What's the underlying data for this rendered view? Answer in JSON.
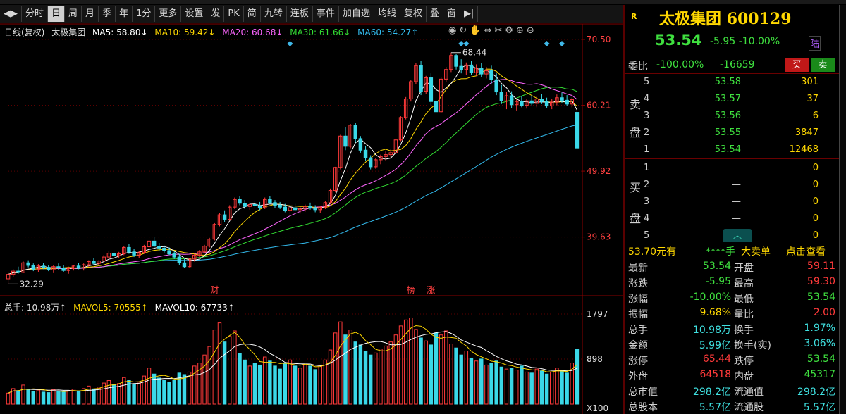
{
  "toolbar": {
    "items": [
      "◀▶",
      "分时",
      "日",
      "周",
      "月",
      "季",
      "年",
      "1分",
      "更多",
      "设置",
      "发",
      "PK",
      "简",
      "九转",
      "连板",
      "事件",
      "加自选",
      "均线",
      "复权",
      "叠",
      "窗",
      "▶|"
    ],
    "active_index": 2
  },
  "legend": {
    "period": "日线(复权)",
    "stock": "太极集团",
    "ma5": "MA5: 58.80↓",
    "ma10": "MA10: 59.42↓",
    "ma20": "MA20: 60.68↓",
    "ma30": "MA30: 61.66↓",
    "ma60": "MA60: 54.27↑"
  },
  "volume_legend": {
    "total": "总手: 10.98万↑",
    "mavol5": "MAVOL5: 70555↑",
    "mavol10": "MAVOL10: 67733↑"
  },
  "axis": {
    "price_ticks": [
      "70.50",
      "60.21",
      "49.92",
      "39.63"
    ],
    "volume_ticks": [
      "1797",
      "898",
      "X100"
    ]
  },
  "annotations": {
    "high": "68.44",
    "low": "32.29",
    "markers": [
      "财",
      "榜",
      "涨"
    ]
  },
  "quote": {
    "badge": "R",
    "name": "太极集团",
    "code": "600129",
    "price": "53.54",
    "change": "-5.95",
    "change_pct": "-10.00%",
    "market": "陆",
    "ratio_label": "委比",
    "ratio_pct": "-100.00%",
    "ratio_diff": "-16659",
    "buy_btn": "买",
    "sell_btn": "卖",
    "sell_side": [
      "卖",
      "盘"
    ],
    "buy_side": [
      "买",
      "盘"
    ],
    "asks": [
      {
        "level": "5",
        "price": "53.58",
        "qty": "301"
      },
      {
        "level": "4",
        "price": "53.57",
        "qty": "37"
      },
      {
        "level": "3",
        "price": "53.56",
        "qty": "6"
      },
      {
        "level": "2",
        "price": "53.55",
        "qty": "3847"
      },
      {
        "level": "1",
        "price": "53.54",
        "qty": "12468"
      }
    ],
    "bids": [
      {
        "level": "1",
        "price": "—",
        "qty": "0"
      },
      {
        "level": "2",
        "price": "—",
        "qty": "0"
      },
      {
        "level": "3",
        "price": "—",
        "qty": "0"
      },
      {
        "level": "4",
        "price": "—",
        "qty": "0"
      },
      {
        "level": "5",
        "price": "—",
        "qty": "0"
      }
    ],
    "level2": {
      "a": "53.70元有",
      "b": "****手",
      "c": "大卖单",
      "d": "点击查看"
    },
    "stats": [
      {
        "l1": "最新",
        "v1": "53.54",
        "c1": "green",
        "l2": "开盘",
        "v2": "59.11",
        "c2": "red"
      },
      {
        "l1": "涨跌",
        "v1": "-5.95",
        "c1": "green",
        "l2": "最高",
        "v2": "59.30",
        "c2": "red"
      },
      {
        "l1": "涨幅",
        "v1": "-10.00%",
        "c1": "green",
        "l2": "最低",
        "v2": "53.54",
        "c2": "green"
      },
      {
        "l1": "振幅",
        "v1": "9.68%",
        "c1": "yel",
        "l2": "量比",
        "v2": "2.00",
        "c2": "red"
      },
      {
        "l1": "总手",
        "v1": "10.98万",
        "c1": "cyan",
        "l2": "换手",
        "v2": "1.97%",
        "c2": "cyan"
      },
      {
        "l1": "金额",
        "v1": "5.99亿",
        "c1": "cyan",
        "l2": "换手(实)",
        "v2": "3.06%",
        "c2": "cyan"
      },
      {
        "l1": "涨停",
        "v1": "65.44",
        "c1": "red",
        "l2": "跌停",
        "v2": "53.54",
        "c2": "green"
      },
      {
        "l1": "外盘",
        "v1": "64518",
        "c1": "red",
        "l2": "内盘",
        "v2": "45317",
        "c2": "green"
      },
      {
        "l1": "总市值",
        "v1": "298.2亿",
        "c1": "cyan",
        "l2": "流通值",
        "v2": "298.2亿",
        "c2": "cyan"
      },
      {
        "l1": "总股本",
        "v1": "5.57亿",
        "c1": "cyan",
        "l2": "流通股",
        "v2": "5.57亿",
        "c2": "cyan"
      }
    ]
  },
  "colors": {
    "up": "#ff3a3a",
    "down": "#3ad8e8",
    "ma5": "#ffffff",
    "ma10": "#ffd800",
    "ma20": "#ff66ff",
    "ma30": "#33dd33",
    "ma60": "#33bbee",
    "axis": "#8a0000"
  },
  "chart_data": {
    "type": "candlestick",
    "y_range": [
      32,
      70.5
    ],
    "candles": [
      [
        33.1,
        34.2,
        32.29,
        33.8
      ],
      [
        33.8,
        34.6,
        33.4,
        34.3
      ],
      [
        34.3,
        35.0,
        33.9,
        34.1
      ],
      [
        34.1,
        35.8,
        34.0,
        35.6
      ],
      [
        35.6,
        36.0,
        34.9,
        35.2
      ],
      [
        35.2,
        35.5,
        34.3,
        34.6
      ],
      [
        34.6,
        35.4,
        34.2,
        35.1
      ],
      [
        35.1,
        35.6,
        34.6,
        34.9
      ],
      [
        34.9,
        35.3,
        34.3,
        34.5
      ],
      [
        34.5,
        35.2,
        34.0,
        35.0
      ],
      [
        35.0,
        35.5,
        34.5,
        34.8
      ],
      [
        34.8,
        35.3,
        34.2,
        34.4
      ],
      [
        34.4,
        35.0,
        33.9,
        34.7
      ],
      [
        34.7,
        35.3,
        34.4,
        35.1
      ],
      [
        35.1,
        35.6,
        34.6,
        34.8
      ],
      [
        34.8,
        35.5,
        34.4,
        35.3
      ],
      [
        35.3,
        36.0,
        35.0,
        35.8
      ],
      [
        35.8,
        36.4,
        35.2,
        35.5
      ],
      [
        35.5,
        36.0,
        35.1,
        35.9
      ],
      [
        35.9,
        36.8,
        35.6,
        36.5
      ],
      [
        36.5,
        37.4,
        36.1,
        37.1
      ],
      [
        37.1,
        37.6,
        36.4,
        36.7
      ],
      [
        36.7,
        37.3,
        36.3,
        37.0
      ],
      [
        37.0,
        38.2,
        36.8,
        38.0
      ],
      [
        38.0,
        38.6,
        37.0,
        37.3
      ],
      [
        37.3,
        37.8,
        36.5,
        36.8
      ],
      [
        36.8,
        37.4,
        36.3,
        37.2
      ],
      [
        37.2,
        38.4,
        37.0,
        38.1
      ],
      [
        38.1,
        39.3,
        37.8,
        39.0
      ],
      [
        39.0,
        39.6,
        37.9,
        38.2
      ],
      [
        38.2,
        38.7,
        37.5,
        37.9
      ],
      [
        37.9,
        38.3,
        37.2,
        37.5
      ],
      [
        37.5,
        38.0,
        36.8,
        37.0
      ],
      [
        37.0,
        37.4,
        36.2,
        36.5
      ],
      [
        36.5,
        37.0,
        35.2,
        35.6
      ],
      [
        35.6,
        36.2,
        34.8,
        35.0
      ],
      [
        35.0,
        36.4,
        34.9,
        36.2
      ],
      [
        36.2,
        37.0,
        35.8,
        36.8
      ],
      [
        36.8,
        37.6,
        36.5,
        37.3
      ],
      [
        37.3,
        38.4,
        37.1,
        38.2
      ],
      [
        38.2,
        39.5,
        38.0,
        39.3
      ],
      [
        39.3,
        41.8,
        39.1,
        41.6
      ],
      [
        41.6,
        43.4,
        41.3,
        43.1
      ],
      [
        43.1,
        43.8,
        42.0,
        42.4
      ],
      [
        42.4,
        44.6,
        42.2,
        44.3
      ],
      [
        44.3,
        45.8,
        44.0,
        45.5
      ],
      [
        45.5,
        46.0,
        44.6,
        44.9
      ],
      [
        44.9,
        45.4,
        44.0,
        44.4
      ],
      [
        44.4,
        45.0,
        43.9,
        44.7
      ],
      [
        44.7,
        45.3,
        44.1,
        44.5
      ],
      [
        44.5,
        45.1,
        43.8,
        44.2
      ],
      [
        44.2,
        45.8,
        44.0,
        45.5
      ],
      [
        45.5,
        46.0,
        44.8,
        45.0
      ],
      [
        45.0,
        45.4,
        44.2,
        44.6
      ],
      [
        44.6,
        45.1,
        44.0,
        44.3
      ],
      [
        44.3,
        44.8,
        43.5,
        43.8
      ],
      [
        43.8,
        44.5,
        43.2,
        44.2
      ],
      [
        44.2,
        44.8,
        43.6,
        43.9
      ],
      [
        43.9,
        44.4,
        43.3,
        44.1
      ],
      [
        44.1,
        44.7,
        43.6,
        44.4
      ],
      [
        44.4,
        45.0,
        43.9,
        44.2
      ],
      [
        44.2,
        44.6,
        43.5,
        43.9
      ],
      [
        43.9,
        44.5,
        43.4,
        44.3
      ],
      [
        44.3,
        45.2,
        44.0,
        45.0
      ],
      [
        45.0,
        47.2,
        44.8,
        46.9
      ],
      [
        46.9,
        50.6,
        46.6,
        50.5
      ],
      [
        50.5,
        55.6,
        50.2,
        55.4
      ],
      [
        55.4,
        56.8,
        53.2,
        53.8
      ],
      [
        53.8,
        57.3,
        53.5,
        57.1
      ],
      [
        57.1,
        57.5,
        54.4,
        55.0
      ],
      [
        55.0,
        55.4,
        52.8,
        53.2
      ],
      [
        53.2,
        53.8,
        51.5,
        52.0
      ],
      [
        52.0,
        52.4,
        50.2,
        50.6
      ],
      [
        50.6,
        52.0,
        50.3,
        51.7
      ],
      [
        51.7,
        52.5,
        51.0,
        52.2
      ],
      [
        52.2,
        53.0,
        51.6,
        52.5
      ],
      [
        52.5,
        53.3,
        51.9,
        52.8
      ],
      [
        52.8,
        55.0,
        52.6,
        54.8
      ],
      [
        54.8,
        58.5,
        54.6,
        58.3
      ],
      [
        58.3,
        61.5,
        58.0,
        61.2
      ],
      [
        61.2,
        64.2,
        60.8,
        63.9
      ],
      [
        63.9,
        66.8,
        63.5,
        66.4
      ],
      [
        66.4,
        67.2,
        61.8,
        62.4
      ],
      [
        62.4,
        64.8,
        62.0,
        64.5
      ],
      [
        64.5,
        65.2,
        60.2,
        60.8
      ],
      [
        60.8,
        61.5,
        58.5,
        59.2
      ],
      [
        59.2,
        64.6,
        59.0,
        64.3
      ],
      [
        64.3,
        66.2,
        63.8,
        65.8
      ],
      [
        65.8,
        68.44,
        65.4,
        68.0
      ],
      [
        68.0,
        68.3,
        65.8,
        66.3
      ],
      [
        66.3,
        67.4,
        65.2,
        65.8
      ],
      [
        65.8,
        66.9,
        65.0,
        66.5
      ],
      [
        66.5,
        67.1,
        64.9,
        65.3
      ],
      [
        65.3,
        66.6,
        64.8,
        66.0
      ],
      [
        66.0,
        66.8,
        64.6,
        65.1
      ],
      [
        65.1,
        66.2,
        64.4,
        65.6
      ],
      [
        65.6,
        66.4,
        63.6,
        64.2
      ],
      [
        64.2,
        65.2,
        61.8,
        62.3
      ],
      [
        62.3,
        63.4,
        60.4,
        60.9
      ],
      [
        60.9,
        62.3,
        59.6,
        61.7
      ],
      [
        61.7,
        62.4,
        59.8,
        60.3
      ],
      [
        60.3,
        61.2,
        59.4,
        60.8
      ],
      [
        60.8,
        61.6,
        59.9,
        60.2
      ],
      [
        60.2,
        61.2,
        59.7,
        60.9
      ],
      [
        60.9,
        61.8,
        60.2,
        60.5
      ],
      [
        60.5,
        61.6,
        59.9,
        61.2
      ],
      [
        61.2,
        62.0,
        60.4,
        60.8
      ],
      [
        60.8,
        61.4,
        59.8,
        60.1
      ],
      [
        60.1,
        61.2,
        59.6,
        60.7
      ],
      [
        60.7,
        61.9,
        60.2,
        61.4
      ],
      [
        61.4,
        62.2,
        60.6,
        61.0
      ],
      [
        61.0,
        61.8,
        60.1,
        60.4
      ],
      [
        60.4,
        61.4,
        59.9,
        61.1
      ],
      [
        59.11,
        59.3,
        53.54,
        53.54
      ]
    ],
    "volume": [
      220,
      310,
      270,
      380,
      300,
      260,
      280,
      240,
      230,
      290,
      260,
      240,
      270,
      300,
      250,
      310,
      360,
      300,
      340,
      420,
      470,
      390,
      410,
      530,
      480,
      400,
      420,
      560,
      720,
      600,
      520,
      470,
      430,
      480,
      620,
      590,
      640,
      760,
      820,
      980,
      1150,
      1480,
      1620,
      1240,
      1350,
      1460,
      1010,
      880,
      760,
      820,
      780,
      940,
      860,
      760,
      700,
      820,
      880,
      760,
      720,
      800,
      760,
      690,
      780,
      880,
      1080,
      1420,
      1640,
      1380,
      1480,
      1240,
      1180,
      1050,
      980,
      1020,
      1100,
      1160,
      1240,
      1380,
      1560,
      1680,
      1720,
      1490,
      1320,
      1260,
      1180,
      1420,
      1380,
      1460,
      1200,
      1120,
      980,
      1060,
      920,
      860,
      900,
      780,
      820,
      860,
      740,
      700,
      720,
      680,
      760,
      640,
      620,
      700,
      660,
      600,
      640,
      720,
      680,
      620,
      820,
      1098
    ],
    "volume_max": 1797
  }
}
